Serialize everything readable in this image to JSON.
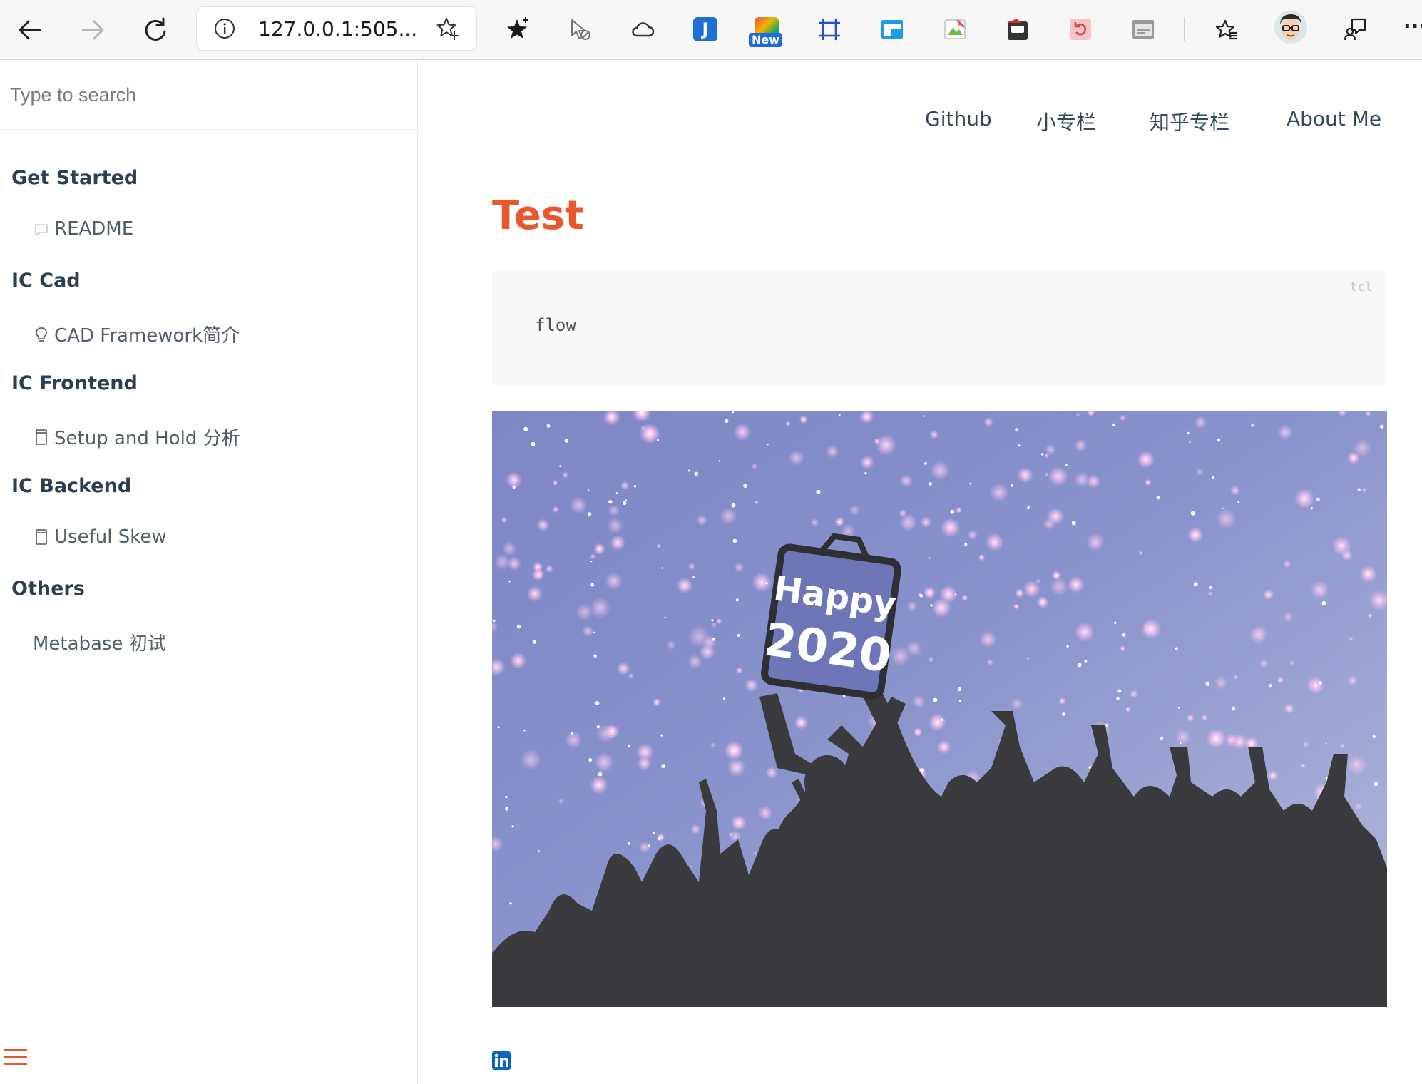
{
  "browser": {
    "address": "127.0.0.1:505...",
    "extensions": [
      {
        "icon": "favorites-star-icon"
      },
      {
        "icon": "cursor-icon"
      },
      {
        "icon": "cloud-icon"
      },
      {
        "icon": "j-extension-icon",
        "letter": "J",
        "color": "#1f6fd8"
      },
      {
        "icon": "new-extension-icon",
        "badge": "New"
      },
      {
        "icon": "crop-icon"
      },
      {
        "icon": "window-icon"
      },
      {
        "icon": "image-icon"
      },
      {
        "icon": "youtube-extension-icon"
      },
      {
        "icon": "restore-icon"
      },
      {
        "icon": "subtitle-icon"
      },
      {
        "icon": "collections-icon"
      },
      {
        "icon": "profile-avatar"
      },
      {
        "icon": "feedback-icon"
      },
      {
        "icon": "more-icon",
        "label": "···"
      }
    ]
  },
  "sidebar": {
    "search_placeholder": "Type to search",
    "sections": [
      {
        "title": "Get Started",
        "items": [
          {
            "label": "README",
            "icon": "comment-icon"
          }
        ]
      },
      {
        "title": "IC Cad",
        "items": [
          {
            "label": "CAD Framework简介",
            "icon": "lightbulb-icon"
          }
        ]
      },
      {
        "title": "IC Frontend",
        "items": [
          {
            "label": "Setup and Hold 分析",
            "icon": "document-icon"
          }
        ]
      },
      {
        "title": "IC Backend",
        "items": [
          {
            "label": "Useful Skew",
            "icon": "document-icon"
          }
        ]
      },
      {
        "title": "Others",
        "items": [
          {
            "label": "Metabase 初试",
            "icon": ""
          }
        ]
      }
    ]
  },
  "main": {
    "nav": [
      "Github",
      "小专栏",
      "知乎专栏",
      "About Me"
    ],
    "title": "Test",
    "code": {
      "lang": "tcl",
      "text": "flow"
    },
    "banner": {
      "line1": "Happy",
      "line2": "2020"
    }
  },
  "colors": {
    "accent": "#e9582c",
    "text": "#34495e",
    "linkedin": "#0a66c2"
  }
}
